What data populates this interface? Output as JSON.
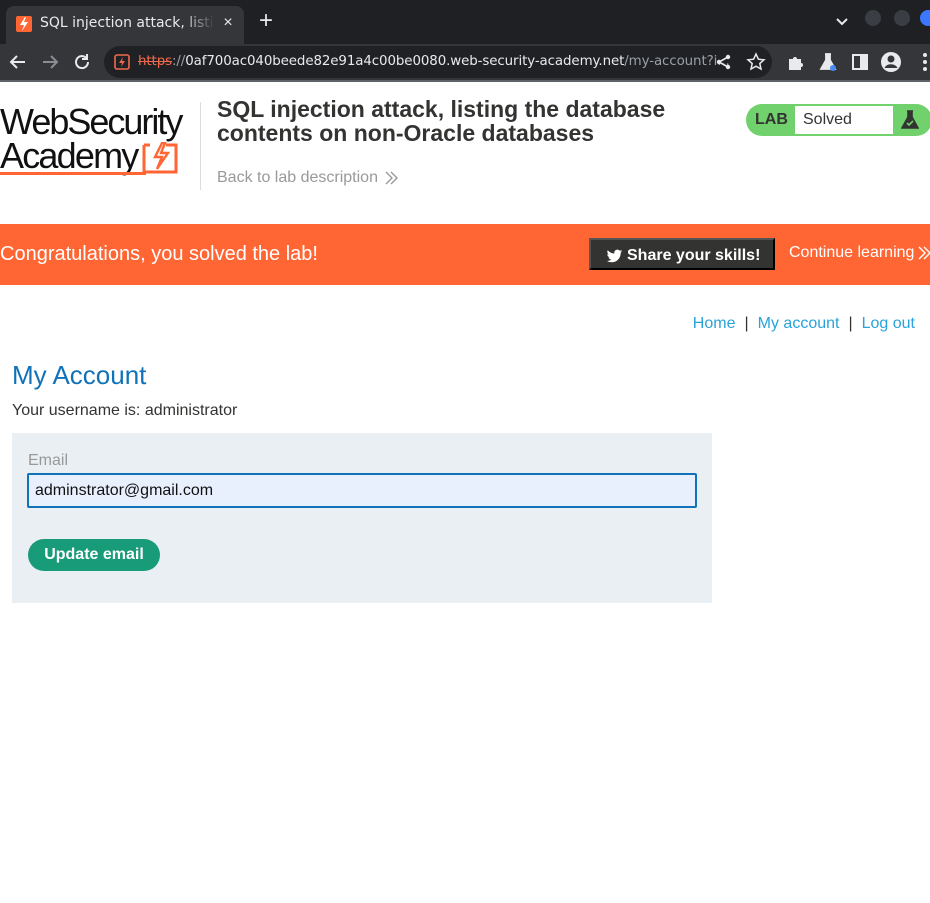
{
  "browser": {
    "tab_title": "SQL injection attack, listing the database contents on non-Oracle databases",
    "tab_close": "×",
    "new_tab": "+",
    "url_scheme": "https",
    "url_sep": "://",
    "url_host": "0af700ac040beede82e91a4c00be0080.web-security-academy.net",
    "url_path": "/my-account?i..."
  },
  "header": {
    "logo_line1": "WebSecurity",
    "logo_line2": "Academy",
    "lab_title": "SQL injection attack, listing the database contents on non-Oracle databases",
    "back_link": "Back to lab description",
    "status_label": "LAB",
    "status_value": "Solved"
  },
  "banner": {
    "message": "Congratulations, you solved the lab!",
    "share_label": "Share your skills!",
    "continue_label": "Continue learning"
  },
  "nav": {
    "home": "Home",
    "separator": "|",
    "my_account": "My account",
    "log_out": "Log out"
  },
  "account": {
    "heading": "My Account",
    "username_line": "Your username is: administrator",
    "email_label": "Email",
    "email_value": "adminstrator@gmail.com",
    "update_button": "Update email"
  },
  "colors": {
    "brand_orange": "#ff6633",
    "solved_green": "#70d16d",
    "heading_blue": "#1072b8",
    "link_blue": "#29a3d9",
    "button_green": "#189b79"
  }
}
